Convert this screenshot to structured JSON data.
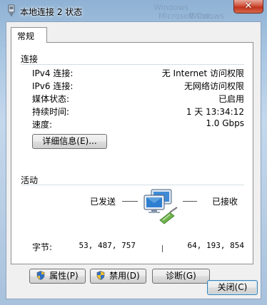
{
  "window": {
    "title": "本地连接 2 状态",
    "close_glyph": "✕",
    "ghost_texts": [
      "Windows",
      "Windows",
      "Microsoft Cor..."
    ]
  },
  "tabs": [
    {
      "label": "常规",
      "selected": true
    }
  ],
  "connection": {
    "section_title": "连接",
    "rows": [
      {
        "label": "IPv4 连接:",
        "value": "无 Internet 访问权限"
      },
      {
        "label": "IPv6 连接:",
        "value": "无网络访问权限"
      },
      {
        "label": "媒体状态:",
        "value": "已启用"
      },
      {
        "label": "持续时间:",
        "value": "1 天 13:34:12"
      },
      {
        "label": "速度:",
        "value": "1.0 Gbps"
      }
    ],
    "details_button": "详细信息(E)..."
  },
  "activity": {
    "section_title": "活动",
    "sent_label": "已发送",
    "received_label": "已接收",
    "bytes_label": "字节:",
    "bytes_sent": "53, 487, 757",
    "bytes_received": "64, 193, 854"
  },
  "buttons": {
    "properties": "属性(P)",
    "disable": "禁用(D)",
    "diagnose": "诊断(G)",
    "close": "关闭(C)"
  },
  "colors": {
    "title_bar": "#a9c6e2",
    "close_button": "#c0331b",
    "default_button_border": "#3c7fb1"
  }
}
